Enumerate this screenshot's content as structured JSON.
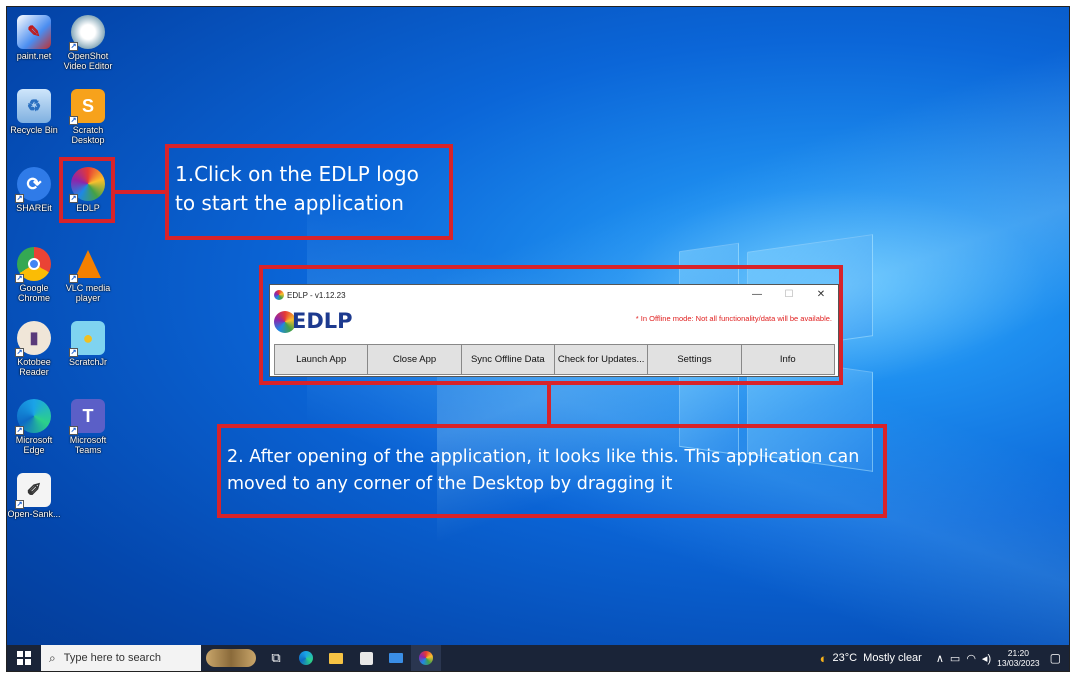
{
  "desktop": {
    "icons": [
      {
        "label": "paint.net"
      },
      {
        "label": "OpenShot Video Editor"
      },
      {
        "label": "Recycle Bin"
      },
      {
        "label": "Scratch Desktop"
      },
      {
        "label": "SHAREit"
      },
      {
        "label": "EDLP"
      },
      {
        "label": "Google Chrome"
      },
      {
        "label": "VLC media player"
      },
      {
        "label": "Kotobee Reader"
      },
      {
        "label": "ScratchJr"
      },
      {
        "label": "Microsoft Edge"
      },
      {
        "label": "Microsoft Teams"
      },
      {
        "label": "Open-Sank..."
      }
    ]
  },
  "annotations": {
    "step1_line1": "1.Click on the EDLP logo",
    "step1_line2": "to start the application",
    "step2_line1": "2. After opening of the application, it looks like this. This application can",
    "step2_line2": "moved to any corner of the Desktop by dragging it",
    "highlight_color": "#d8232a"
  },
  "edlp_window": {
    "title": "EDLP - v1.12.23",
    "logo_text": "EDLP",
    "offline_notice": "* In Offline mode: Not all functionality/data will be available.",
    "controls": {
      "minimize": "—",
      "maximize": "☐",
      "close": "✕"
    },
    "buttons": [
      "Launch App",
      "Close App",
      "Sync Offline Data",
      "Check for Updates...",
      "Settings",
      "Info"
    ]
  },
  "taskbar": {
    "search_placeholder": "Type here to search",
    "weather": "23°C  Mostly clear",
    "time": "21:20",
    "date": "13/03/2023"
  }
}
